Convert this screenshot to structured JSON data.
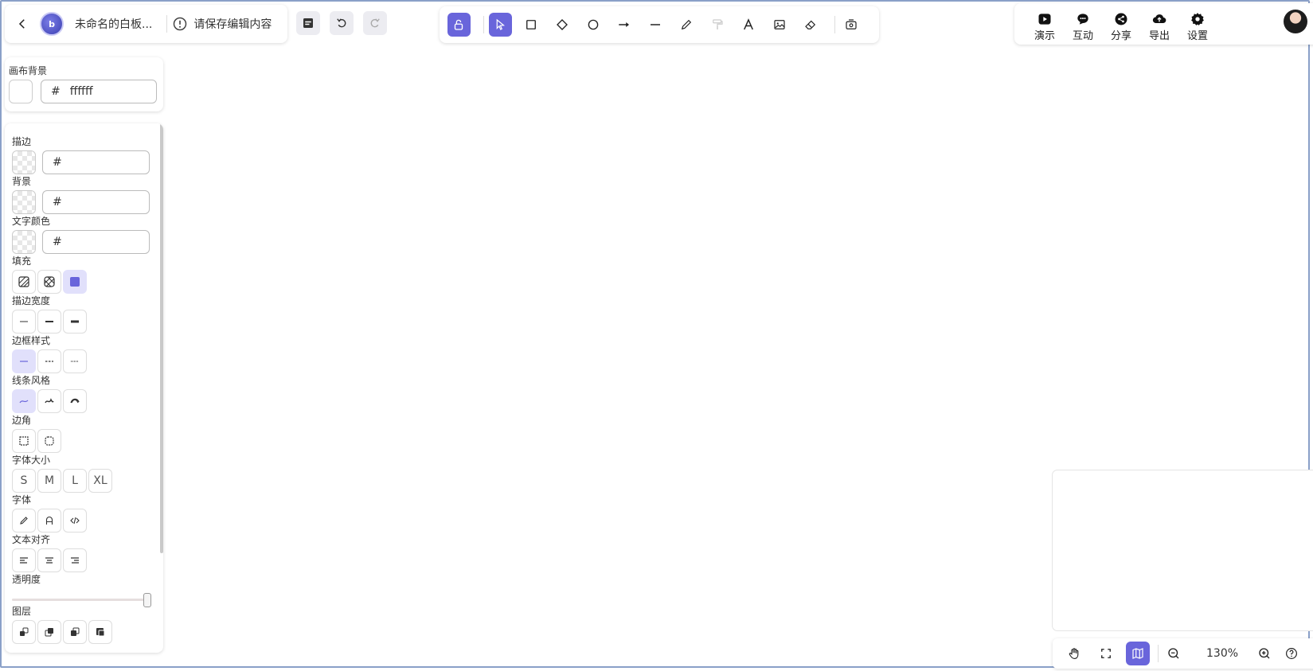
{
  "header": {
    "title": "未命名的白板...",
    "save_warning": "请保存编辑内容"
  },
  "toolbar": {
    "tools": [
      "lock-icon",
      "pointer-icon",
      "rectangle-icon",
      "diamond-icon",
      "circle-icon",
      "arrow-icon",
      "line-icon",
      "pencil-icon",
      "paint-roller-icon",
      "text-icon",
      "image-icon",
      "eraser-icon",
      "library-icon"
    ],
    "active_tool": "pointer-icon"
  },
  "rightbar": {
    "present": "演示",
    "interact": "互动",
    "share": "分享",
    "export": "导出",
    "settings": "设置"
  },
  "canvas_bg": {
    "label": "画布背景",
    "hash": "#",
    "value": "ffffff"
  },
  "props": {
    "stroke": "描边",
    "background": "背景",
    "text_color": "文字颜色",
    "hash": "#",
    "fill": "填充",
    "stroke_width": "描边宽度",
    "border_style": "边框样式",
    "line_style": "线条风格",
    "corner": "边角",
    "font_size": "字体大小",
    "sizes": [
      "S",
      "M",
      "L",
      "XL"
    ],
    "font": "字体",
    "text_align": "文本对齐",
    "opacity": "透明度",
    "opacity_value": 1.0,
    "layer": "图层"
  },
  "bottom": {
    "zoom": "130%"
  },
  "colors": {
    "accent": "#6965db",
    "accent_light": "#e1e0fb"
  }
}
